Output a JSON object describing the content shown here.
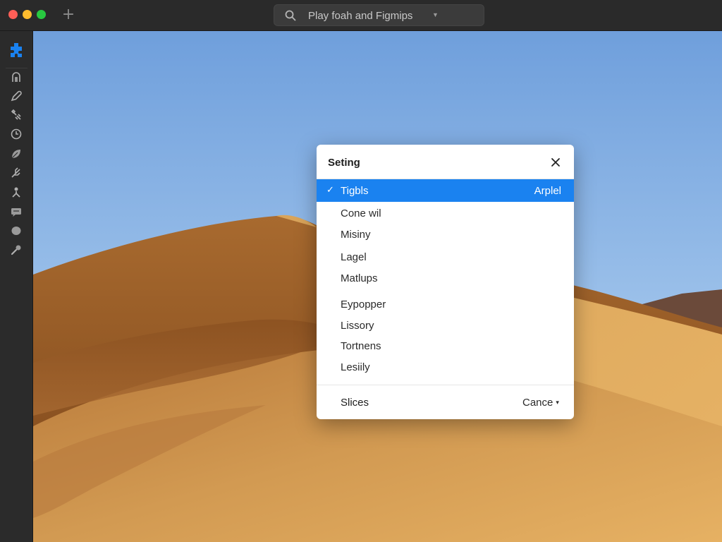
{
  "window": {
    "search": {
      "text": "Play foah and Figmips",
      "icon": "search-icon",
      "caret_icon": "chevron-down-icon"
    },
    "new_tab_label": "+"
  },
  "sidebar": {
    "logo_icon": "plugin-icon",
    "accent": "#1a82f0",
    "items": [
      {
        "icon": "home-icon"
      },
      {
        "icon": "pen-icon"
      },
      {
        "icon": "tools-icon"
      },
      {
        "icon": "clock-icon"
      },
      {
        "icon": "leaf-icon"
      },
      {
        "icon": "feather-icon"
      },
      {
        "icon": "person-icon"
      },
      {
        "icon": "message-icon"
      },
      {
        "icon": "circle-icon"
      },
      {
        "icon": "wrench-icon"
      }
    ]
  },
  "dialog": {
    "title": "Seting",
    "close_icon": "close-icon",
    "items": [
      {
        "label": "Tigbls",
        "selected": true,
        "check": "✓",
        "right": "Arplel"
      },
      {
        "label": "Cone wil"
      },
      {
        "label": "Misiny"
      },
      {
        "label": "Lagel"
      },
      {
        "label": "Matlups"
      },
      {
        "label": "Eypopper"
      },
      {
        "label": "Lissory"
      },
      {
        "label": "Tortnens"
      },
      {
        "label": "Lesiily"
      }
    ],
    "footer": {
      "left": "Slices",
      "right": "Cance",
      "right_caret": "▾"
    }
  },
  "colors": {
    "selection": "#1a82f0",
    "titlebar": "#2a2a2a",
    "sidebar": "#2b2b2b"
  }
}
